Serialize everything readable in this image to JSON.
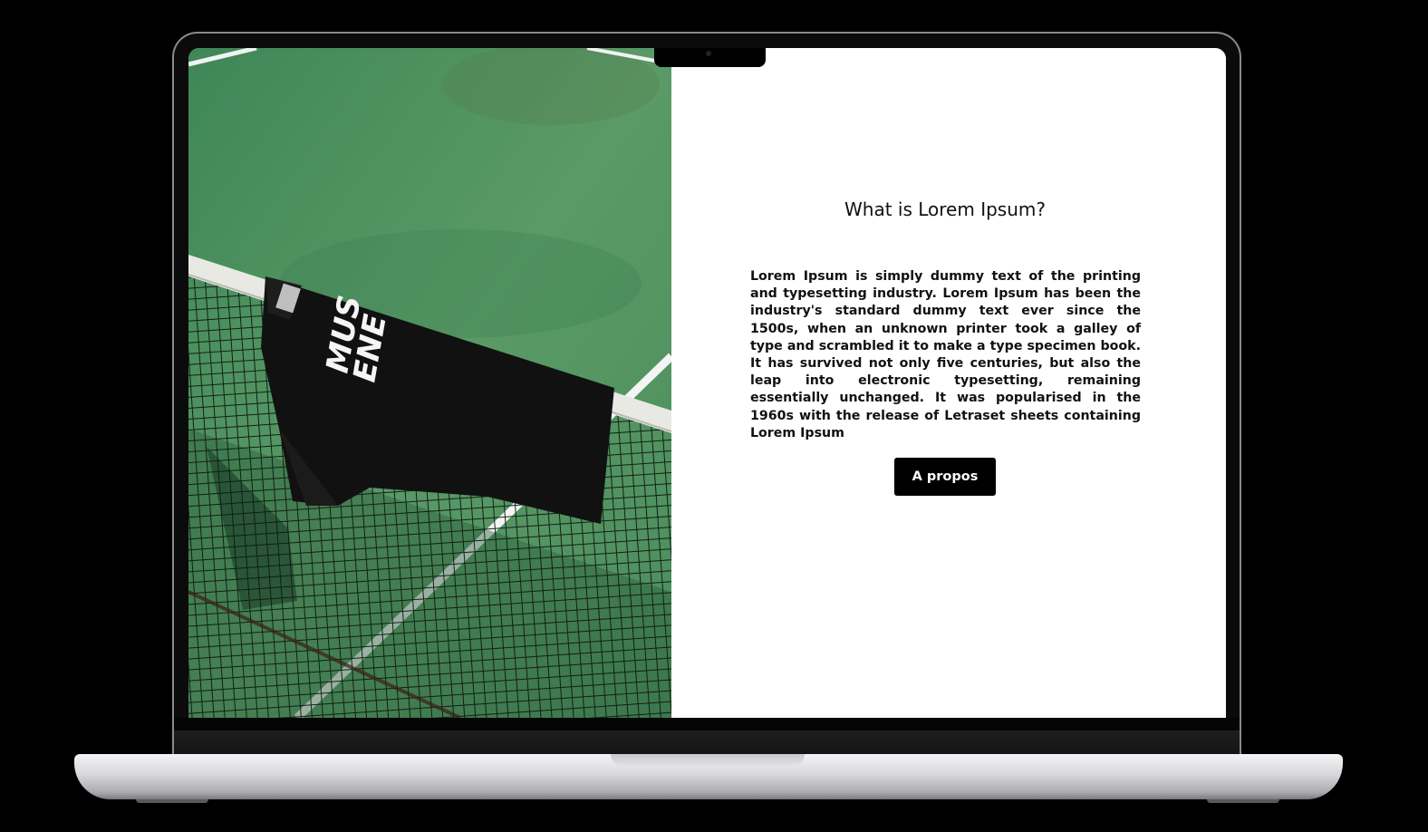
{
  "hero": {
    "title": "What is Lorem Ipsum?",
    "body": "Lorem Ipsum is simply dummy text of the printing and typesetting industry. Lorem Ipsum has been the industry's standard dummy text ever since the 1500s, when an unknown printer took a galley of type and scrambled it to make a type specimen book. It has survived not only five centuries, but also the leap into electronic typesetting, remaining essentially unchanged. It was popularised in the 1960s with the release of Letraset sheets containing Lorem Ipsum",
    "button_label": "A propos"
  },
  "photo": {
    "shirt_print": [
      "MUS",
      "ENE"
    ]
  },
  "colors": {
    "court_green": "#4e9160",
    "shirt_black": "#111111",
    "button_bg": "#000000",
    "button_text": "#ffffff"
  }
}
